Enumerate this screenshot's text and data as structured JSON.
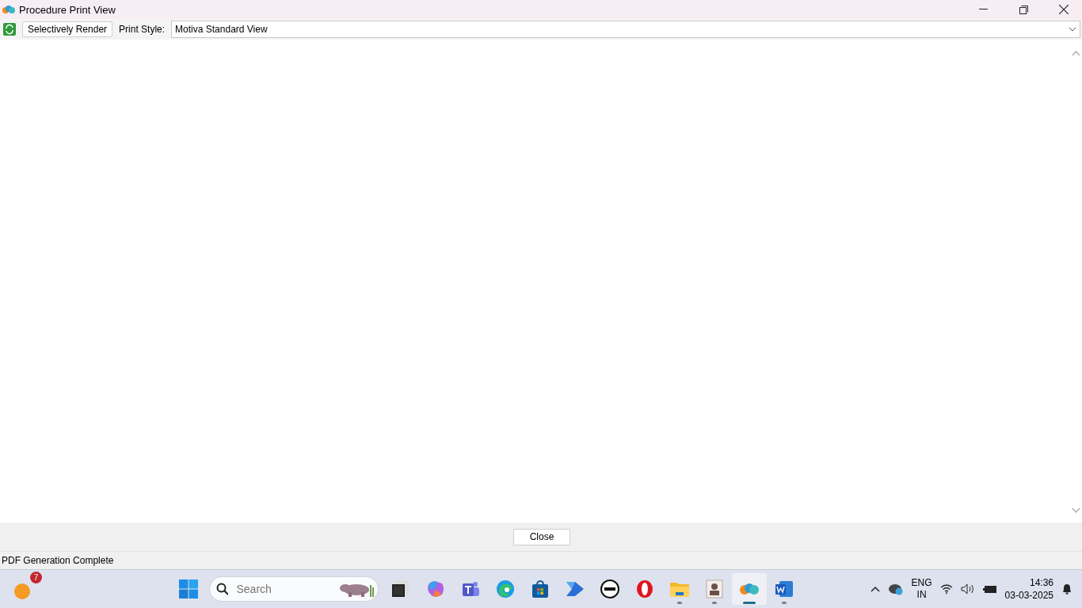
{
  "window": {
    "title": "Procedure Print View"
  },
  "toolbar": {
    "button": "Selectively Render",
    "style_label": "Print Style:",
    "style_value": "Motiva Standard View"
  },
  "footer": {
    "close_button": "Close"
  },
  "status_bar": "PDF Generation Complete",
  "taskbar": {
    "notification_count": "7",
    "search_placeholder": "Search",
    "apps": [
      {
        "kind": "taskview",
        "running": false,
        "selected": false
      },
      {
        "kind": "copilot",
        "running": false,
        "selected": false
      },
      {
        "kind": "teams",
        "running": false,
        "selected": false
      },
      {
        "kind": "edge",
        "running": false,
        "selected": false
      },
      {
        "kind": "store",
        "running": false,
        "selected": false
      },
      {
        "kind": "automate",
        "running": false,
        "selected": false
      },
      {
        "kind": "dell",
        "running": false,
        "selected": false
      },
      {
        "kind": "opera",
        "running": false,
        "selected": false
      },
      {
        "kind": "folder",
        "running": true,
        "selected": false
      },
      {
        "kind": "contact",
        "running": true,
        "selected": false
      },
      {
        "kind": "cloud",
        "running": true,
        "selected": true
      },
      {
        "kind": "word",
        "running": true,
        "selected": false
      }
    ],
    "language": "ENG",
    "region": "IN",
    "time": "14:36",
    "date": "03-03-2025"
  }
}
